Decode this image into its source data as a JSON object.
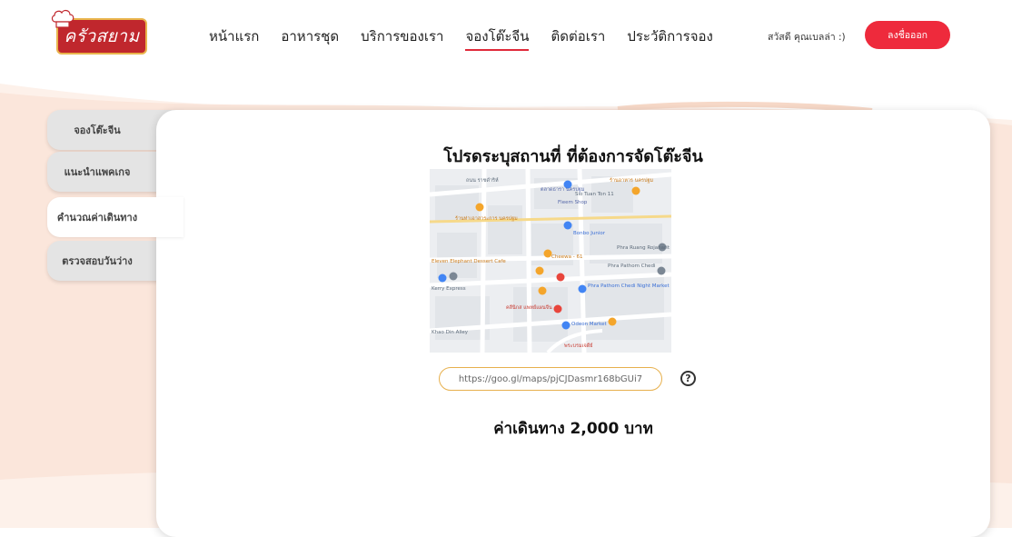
{
  "header": {
    "logo_text": "ครัวสยาม",
    "nav": [
      {
        "label": "หน้าแรก",
        "active": false
      },
      {
        "label": "อาหารชุด",
        "active": false
      },
      {
        "label": "บริการของเรา",
        "active": false
      },
      {
        "label": "จองโต๊ะจีน",
        "active": true
      },
      {
        "label": "ติดต่อเรา",
        "active": false
      },
      {
        "label": "ประวัติการจอง",
        "active": false
      }
    ],
    "greeting": "สวัสดี คุณเบลล่า :)",
    "logout_label": "ลงชื่อออก"
  },
  "sidebar": {
    "tabs": [
      {
        "label": "จองโต๊ะจีน",
        "active": false
      },
      {
        "label": "แนะนำแพคเกจ",
        "active": false
      },
      {
        "label": "คำนวณค่าเดินทาง",
        "active": true
      },
      {
        "label": "ตรวจสอบวันว่าง",
        "active": false
      }
    ]
  },
  "main": {
    "title": "โปรดระบุสถานที่ ที่ต้องการจัดโต๊ะจีน",
    "url_value": "https://goo.gl/maps/pjCJDasmr168bGUi7",
    "help_icon": "help-circle-icon",
    "cost_text": "ค่าเดินทาง 2,000 บาท"
  },
  "map": {
    "labels": [
      "ถนน ราชดำริห์",
      "ตลาดธารา นครปฐม",
      "Sio Tuan Ton 11",
      "Fleem Shop",
      "ร้านท่าเอาสาระการ นครปฐม",
      "ร้านอาหาร นครปฐม",
      "Bonbo Junior",
      "Phra Ruang Rojanarit",
      "Cheewa - 61",
      "Eleven Elephant Dessert Cafe",
      "Phra Pathom Chedi",
      "Kerry Express",
      "Phra Pathom Chedi Night Market",
      "คลีนิกส แพทย์แผนจีน",
      "Odeon Market",
      "Khao Din Alley",
      "พระบรมเจดีย์"
    ]
  },
  "colors": {
    "accent_red": "#ee2a3c",
    "gold": "#e7b04d",
    "wave": "#fbe9e0"
  }
}
